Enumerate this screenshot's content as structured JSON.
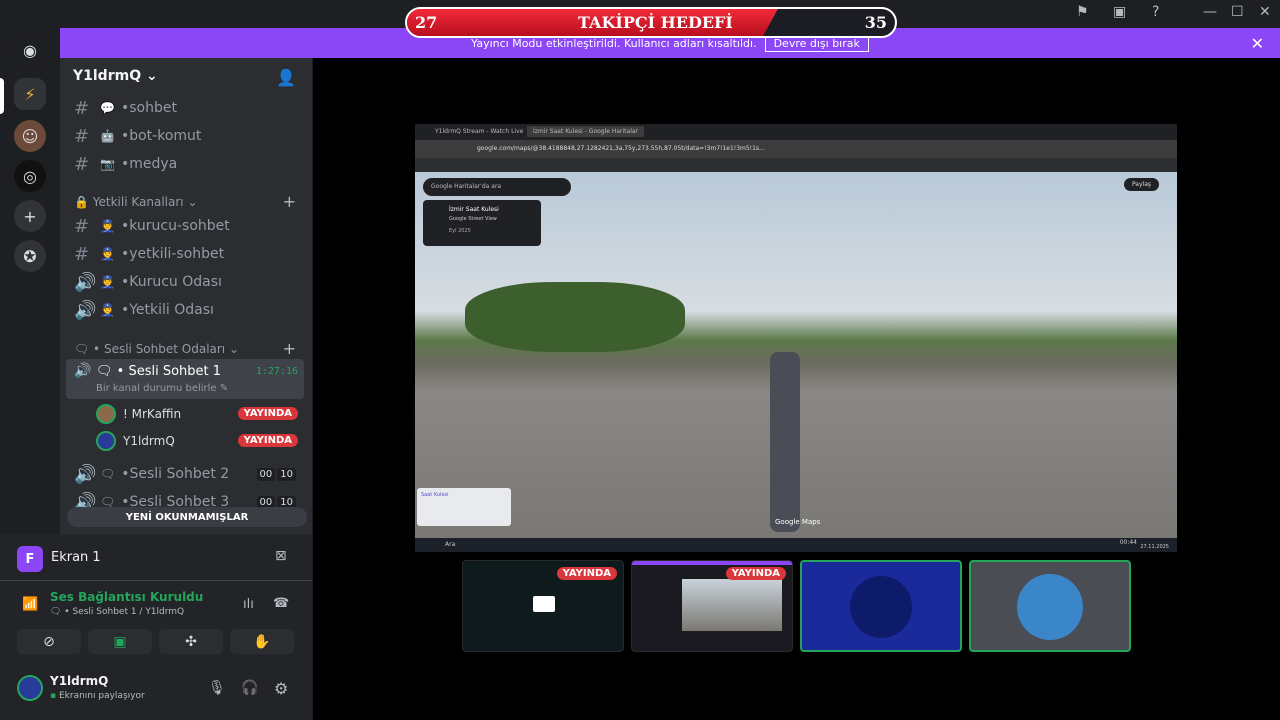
{
  "goal": {
    "left": "27",
    "title": "TAKİPÇİ HEDEFİ",
    "right": "35"
  },
  "banner": {
    "text": "Yayıncı Modu etkinleştirildi. Kullanıcı adları kısaltıldı.",
    "button": "Devre dışı bırak"
  },
  "server": {
    "name": "Y1ldrmQ"
  },
  "channels": {
    "top": [
      {
        "name": "sohbet",
        "emoji": "💬"
      },
      {
        "name": "bot-komut",
        "emoji": "🤖"
      },
      {
        "name": "medya",
        "emoji": "📷"
      }
    ],
    "cat1": "Yetkili Kanalları",
    "cat1_items": [
      {
        "name": "kurucu-sohbet",
        "type": "text"
      },
      {
        "name": "yetkili-sohbet",
        "type": "text"
      },
      {
        "name": "Kurucu Odası",
        "type": "voice"
      },
      {
        "name": "Yetkili Odası",
        "type": "voice"
      }
    ],
    "cat2": "Sesli Sohbet Odaları",
    "active": {
      "name": "Sesli Sohbet 1",
      "time": "1:27:16",
      "status": "Bir kanal durumu belirle"
    },
    "users": [
      {
        "name": "! MrKaffin",
        "badge": "YAYINDA"
      },
      {
        "name": "Y1ldrmQ",
        "badge": "YAYINDA"
      }
    ],
    "others": [
      {
        "name": "Sesli Sohbet 2",
        "a": "00",
        "b": "10"
      },
      {
        "name": "Sesli Sohbet 3",
        "a": "00",
        "b": "10"
      }
    ],
    "unread": "YENİ OKUNMAMIŞLAR"
  },
  "screen": {
    "initial": "F",
    "title": "Ekran 1"
  },
  "voice": {
    "status": "Ses Bağlantısı Kuruldu",
    "path": "Sesli Sohbet 1 / Y1ldrmQ"
  },
  "account": {
    "name": "Y1ldrmQ",
    "status": "Ekranını paylaşıyor"
  },
  "browser": {
    "tab1": "Y1ldrmQ Stream - Watch Live",
    "tab2": "İzmir Saat Kulesi - Google Haritalar",
    "url": "google.com/maps/@38.4188848,27.1282421,3a,75y,273.55h,87.05t/data=!3m7!1e1!3m5!1s...",
    "search_placeholder": "Google Haritalar'da ara",
    "place": "İzmir Saat Kulesi",
    "place_sub": "Google Street View",
    "place_date": "Eyl 2025",
    "share": "Paylaş",
    "watermark": "Google Maps",
    "mini_label": "Saat Kulesi",
    "taskbar_search": "Ara",
    "clock": "00:44",
    "date": "27.11.2025"
  },
  "tiles": [
    {
      "badge": "YAYINDA"
    },
    {
      "badge": "YAYINDA"
    }
  ],
  "colors": {
    "accent": "#8b46f5",
    "live": "#da373c",
    "connected": "#23a55a"
  }
}
